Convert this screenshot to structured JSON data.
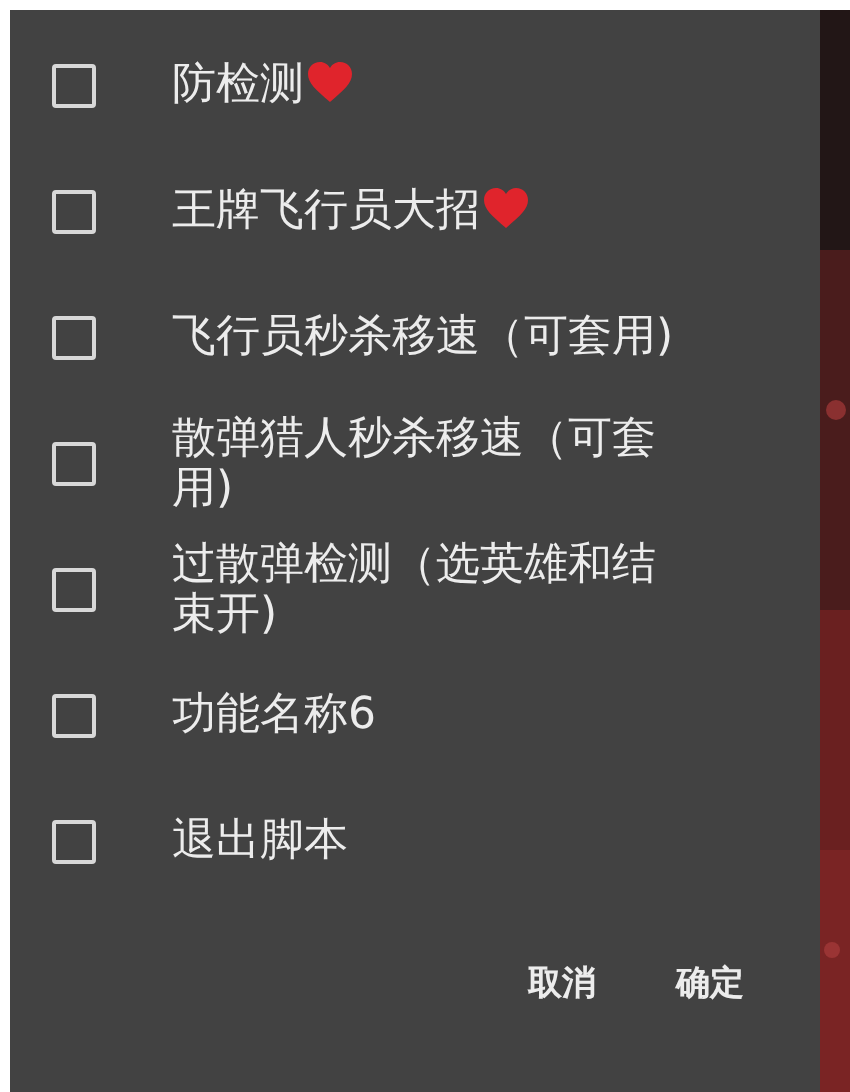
{
  "dialog": {
    "items": [
      {
        "label": "防检测",
        "checked": false,
        "heart": true
      },
      {
        "label": "王牌飞行员大招",
        "checked": false,
        "heart": true
      },
      {
        "label": "飞行员秒杀移速（可套用)",
        "checked": false,
        "heart": false
      },
      {
        "label": "散弹猎人秒杀移速（可套用)",
        "checked": false,
        "heart": false
      },
      {
        "label": "过散弹检测（选英雄和结束开)",
        "checked": false,
        "heart": false
      },
      {
        "label": "功能名称6",
        "checked": false,
        "heart": false
      },
      {
        "label": "退出脚本",
        "checked": false,
        "heart": false
      }
    ],
    "buttons": [
      "取消",
      "确定"
    ]
  }
}
